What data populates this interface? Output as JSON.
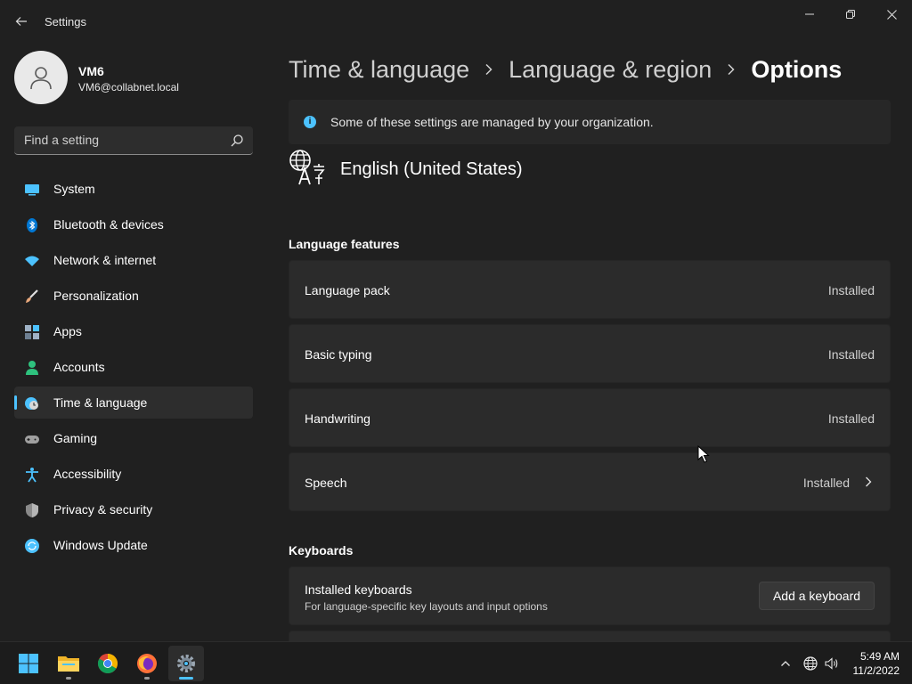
{
  "window": {
    "title": "Settings",
    "controls": {
      "minimize": "minimize",
      "maximize": "restore",
      "close": "close"
    }
  },
  "profile": {
    "name": "VM6",
    "email": "VM6@collabnet.local"
  },
  "search": {
    "placeholder": "Find a setting",
    "value": ""
  },
  "nav": {
    "selected": "Time & language",
    "items": [
      {
        "label": "System",
        "icon": "system-icon",
        "color": "#4cc2ff"
      },
      {
        "label": "Bluetooth & devices",
        "icon": "bluetooth-icon",
        "color": "#0078d4"
      },
      {
        "label": "Network & internet",
        "icon": "wifi-icon",
        "color": "#4cc2ff"
      },
      {
        "label": "Personalization",
        "icon": "brush-icon",
        "color": "#e8a87c"
      },
      {
        "label": "Apps",
        "icon": "apps-icon",
        "color": "#9fb2c6"
      },
      {
        "label": "Accounts",
        "icon": "person-icon",
        "color": "#2ec27e"
      },
      {
        "label": "Time & language",
        "icon": "clock-globe-icon",
        "color": "#4cc2ff"
      },
      {
        "label": "Gaming",
        "icon": "gamepad-icon",
        "color": "#a0a0a0"
      },
      {
        "label": "Accessibility",
        "icon": "accessibility-icon",
        "color": "#4cc2ff"
      },
      {
        "label": "Privacy & security",
        "icon": "shield-icon",
        "color": "#8a8a8a"
      },
      {
        "label": "Windows Update",
        "icon": "update-icon",
        "color": "#4cc2ff"
      }
    ]
  },
  "breadcrumb": {
    "items": [
      "Time & language",
      "Language & region"
    ],
    "current": "Options"
  },
  "info_bar": {
    "text": "Some of these settings are managed by your organization."
  },
  "language": {
    "name": "English (United States)",
    "icon": "language-icon"
  },
  "language_features": {
    "title": "Language features",
    "items": [
      {
        "label": "Language pack",
        "status": "Installed",
        "chevron": false
      },
      {
        "label": "Basic typing",
        "status": "Installed",
        "chevron": false
      },
      {
        "label": "Handwriting",
        "status": "Installed",
        "chevron": false
      },
      {
        "label": "Speech",
        "status": "Installed",
        "chevron": true
      }
    ]
  },
  "keyboards": {
    "title": "Keyboards",
    "installed_title": "Installed keyboards",
    "installed_subtitle": "For language-specific key layouts and input options",
    "add_button": "Add a keyboard"
  },
  "taskbar": {
    "apps": [
      "start-icon",
      "file-explorer-icon",
      "chrome-icon",
      "firefox-icon",
      "settings-icon"
    ],
    "active_app": "settings-icon",
    "tray": [
      "chevron-up-icon",
      "network-globe-icon",
      "volume-icon"
    ],
    "time": "5:49 AM",
    "date": "11/2/2022"
  },
  "colors": {
    "background": "#202020",
    "accent": "#4cc2ff",
    "card": "#2b2b2b"
  }
}
